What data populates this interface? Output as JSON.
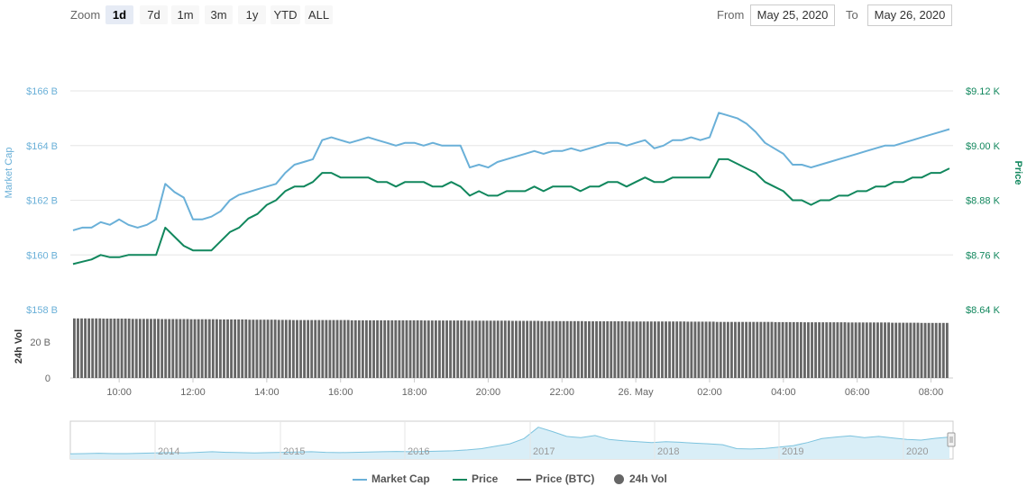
{
  "toolbar": {
    "zoom_label": "Zoom",
    "buttons": [
      "1d",
      "7d",
      "1m",
      "3m",
      "1y",
      "YTD",
      "ALL"
    ],
    "selected": "1d",
    "from_label": "From",
    "from_value": "May 25, 2020",
    "to_label": "To",
    "to_value": "May 26, 2020"
  },
  "colors": {
    "market_cap": "#6ab0d8",
    "price": "#11875d",
    "price_btc": "#555555",
    "volume": "#666666",
    "navigator": "#7cc3de"
  },
  "chart_data": {
    "type": "line",
    "x_tick_labels": [
      "10:00",
      "12:00",
      "14:00",
      "16:00",
      "18:00",
      "20:00",
      "22:00",
      "26. May",
      "02:00",
      "04:00",
      "06:00",
      "08:00"
    ],
    "left_axis": {
      "title": "Market Cap",
      "ticks": [
        "$166 B",
        "$164 B",
        "$162 B",
        "$160 B",
        "$158 B"
      ],
      "range": [
        158,
        166
      ]
    },
    "right_axis": {
      "title": "Price",
      "ticks": [
        "$9.12 K",
        "$9.00 K",
        "$8.88 K",
        "$8.76 K",
        "$8.64 K"
      ],
      "range": [
        8.64,
        9.12
      ]
    },
    "volume_axis": {
      "title": "24h Vol",
      "ticks": [
        "20 B",
        "0"
      ],
      "range": [
        0,
        20
      ]
    },
    "series": [
      {
        "name": "Market Cap",
        "axis": "left",
        "x": [
          0,
          0.25,
          0.5,
          0.75,
          1,
          1.25,
          1.5,
          1.75,
          2,
          2.25,
          2.5,
          2.75,
          3,
          3.25,
          3.5,
          3.75,
          4,
          4.25,
          4.5,
          4.75,
          5,
          5.25,
          5.5,
          5.75,
          6,
          6.25,
          6.5,
          6.75,
          7,
          7.25,
          7.5,
          7.75,
          8,
          8.25,
          8.5,
          8.75,
          9,
          9.25,
          9.5,
          9.75,
          10,
          10.25,
          10.5,
          10.75,
          11,
          11.25,
          11.5,
          11.75,
          12,
          12.25,
          12.5,
          12.75,
          13,
          13.25,
          13.5,
          13.75,
          14,
          14.25,
          14.5,
          14.75,
          15,
          15.25,
          15.5,
          15.75,
          16,
          16.25,
          16.5,
          16.75,
          17,
          17.25,
          17.5,
          17.75,
          18,
          18.25,
          18.5,
          18.75,
          19,
          19.25,
          19.5,
          19.75,
          20,
          20.25,
          20.5,
          20.75,
          21,
          21.25,
          21.5,
          21.75,
          22,
          22.25,
          22.5,
          22.75,
          23,
          23.25,
          23.5,
          23.75
        ],
        "values": [
          160.9,
          161.0,
          161.0,
          161.2,
          161.1,
          161.3,
          161.1,
          161.0,
          161.1,
          161.3,
          162.6,
          162.3,
          162.1,
          161.3,
          161.3,
          161.4,
          161.6,
          162.0,
          162.2,
          162.3,
          162.4,
          162.5,
          162.6,
          163.0,
          163.3,
          163.4,
          163.5,
          164.2,
          164.3,
          164.2,
          164.1,
          164.2,
          164.3,
          164.2,
          164.1,
          164.0,
          164.1,
          164.1,
          164.0,
          164.1,
          164.0,
          164.0,
          164.0,
          163.2,
          163.3,
          163.2,
          163.4,
          163.5,
          163.6,
          163.7,
          163.8,
          163.7,
          163.8,
          163.8,
          163.9,
          163.8,
          163.9,
          164.0,
          164.1,
          164.1,
          164.0,
          164.1,
          164.2,
          163.9,
          164.0,
          164.2,
          164.2,
          164.3,
          164.2,
          164.3,
          165.2,
          165.1,
          165.0,
          164.8,
          164.5,
          164.1,
          163.9,
          163.7,
          163.3,
          163.3,
          163.2,
          163.3,
          163.4,
          163.5,
          163.6,
          163.7,
          163.8,
          163.9,
          164.0,
          164.0,
          164.1,
          164.2,
          164.3,
          164.4,
          164.5,
          164.6
        ]
      },
      {
        "name": "Price",
        "axis": "right",
        "x": [
          0,
          0.25,
          0.5,
          0.75,
          1,
          1.25,
          1.5,
          1.75,
          2,
          2.25,
          2.5,
          2.75,
          3,
          3.25,
          3.5,
          3.75,
          4,
          4.25,
          4.5,
          4.75,
          5,
          5.25,
          5.5,
          5.75,
          6,
          6.25,
          6.5,
          6.75,
          7,
          7.25,
          7.5,
          7.75,
          8,
          8.25,
          8.5,
          8.75,
          9,
          9.25,
          9.5,
          9.75,
          10,
          10.25,
          10.5,
          10.75,
          11,
          11.25,
          11.5,
          11.75,
          12,
          12.25,
          12.5,
          12.75,
          13,
          13.25,
          13.5,
          13.75,
          14,
          14.25,
          14.5,
          14.75,
          15,
          15.25,
          15.5,
          15.75,
          16,
          16.25,
          16.5,
          16.75,
          17,
          17.25,
          17.5,
          17.75,
          18,
          18.25,
          18.5,
          18.75,
          19,
          19.25,
          19.5,
          19.75,
          20,
          20.25,
          20.5,
          20.75,
          21,
          21.25,
          21.5,
          21.75,
          22,
          22.25,
          22.5,
          22.75,
          23,
          23.25,
          23.5,
          23.75
        ],
        "values": [
          8.74,
          8.745,
          8.75,
          8.76,
          8.755,
          8.755,
          8.76,
          8.76,
          8.76,
          8.76,
          8.82,
          8.8,
          8.78,
          8.77,
          8.77,
          8.77,
          8.79,
          8.81,
          8.82,
          8.84,
          8.85,
          8.87,
          8.88,
          8.9,
          8.91,
          8.91,
          8.92,
          8.94,
          8.94,
          8.93,
          8.93,
          8.93,
          8.93,
          8.92,
          8.92,
          8.91,
          8.92,
          8.92,
          8.92,
          8.91,
          8.91,
          8.92,
          8.91,
          8.89,
          8.9,
          8.89,
          8.89,
          8.9,
          8.9,
          8.9,
          8.91,
          8.9,
          8.91,
          8.91,
          8.91,
          8.9,
          8.91,
          8.91,
          8.92,
          8.92,
          8.91,
          8.92,
          8.93,
          8.92,
          8.92,
          8.93,
          8.93,
          8.93,
          8.93,
          8.93,
          8.97,
          8.97,
          8.96,
          8.95,
          8.94,
          8.92,
          8.91,
          8.9,
          8.88,
          8.88,
          8.87,
          8.88,
          8.88,
          8.89,
          8.89,
          8.9,
          8.9,
          8.91,
          8.91,
          8.92,
          8.92,
          8.93,
          8.93,
          8.94,
          8.94,
          8.95
        ]
      }
    ],
    "volume": {
      "name": "24h Vol",
      "values": [
        29.2,
        29.2,
        29.1,
        29.1,
        29.0,
        29.0,
        28.9,
        28.9,
        28.8,
        28.8,
        28.7,
        28.7,
        28.6,
        28.6,
        28.5,
        28.4,
        28.4,
        28.4,
        28.4,
        28.3,
        28.3,
        28.3,
        28.3,
        28.3,
        28.2,
        28.2,
        28.2,
        28.1,
        28.1,
        28.1,
        28.0,
        28.0,
        27.9,
        27.9,
        27.9,
        27.8,
        27.8,
        27.8,
        27.7,
        27.7,
        27.7,
        27.7,
        27.6,
        27.6,
        27.5,
        27.5,
        27.5,
        27.5,
        27.4,
        27.4,
        27.3,
        27.3,
        27.3,
        27.2,
        27.2,
        27.2,
        27.1,
        27.1,
        27.0,
        27.0
      ]
    },
    "navigator": {
      "year_labels": [
        "2014",
        "2015",
        "2016",
        "2017",
        "2018",
        "2019",
        "2020"
      ],
      "values": [
        0.05,
        0.06,
        0.07,
        0.06,
        0.06,
        0.07,
        0.08,
        0.09,
        0.08,
        0.1,
        0.12,
        0.1,
        0.09,
        0.08,
        0.09,
        0.1,
        0.11,
        0.12,
        0.1,
        0.09,
        0.1,
        0.11,
        0.12,
        0.13,
        0.12,
        0.13,
        0.14,
        0.15,
        0.18,
        0.22,
        0.3,
        0.38,
        0.55,
        0.92,
        0.78,
        0.62,
        0.58,
        0.65,
        0.52,
        0.48,
        0.45,
        0.42,
        0.45,
        0.43,
        0.4,
        0.38,
        0.35,
        0.22,
        0.21,
        0.23,
        0.27,
        0.32,
        0.42,
        0.55,
        0.6,
        0.64,
        0.58,
        0.62,
        0.57,
        0.52,
        0.5,
        0.56,
        0.6
      ]
    },
    "legend": [
      "Market Cap",
      "Price",
      "Price (BTC)",
      "24h Vol"
    ]
  }
}
